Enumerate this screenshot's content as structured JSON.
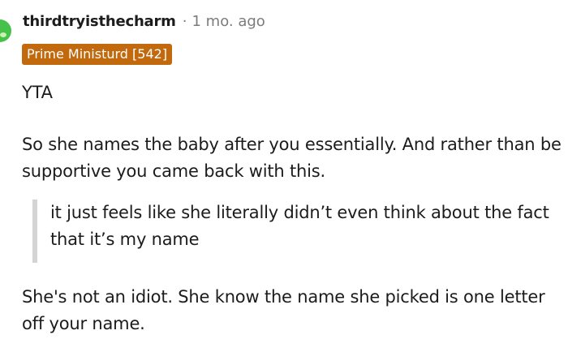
{
  "comment": {
    "username": "thirdtryisthecharm",
    "separator": "·",
    "time_ago": "1 mo. ago",
    "flair": "Prime Ministurd [542]",
    "flair_color": "#c2690d",
    "avatar_color": "#46c24a",
    "paragraphs": [
      "YTA",
      "So she names the baby after you essentially. And rather than be supportive you came back with this."
    ],
    "quote": "it just feels like she literally didn’t even think about the fact that it’s my name",
    "closing": "She's not an idiot. She know the name she picked is one letter off your name."
  }
}
